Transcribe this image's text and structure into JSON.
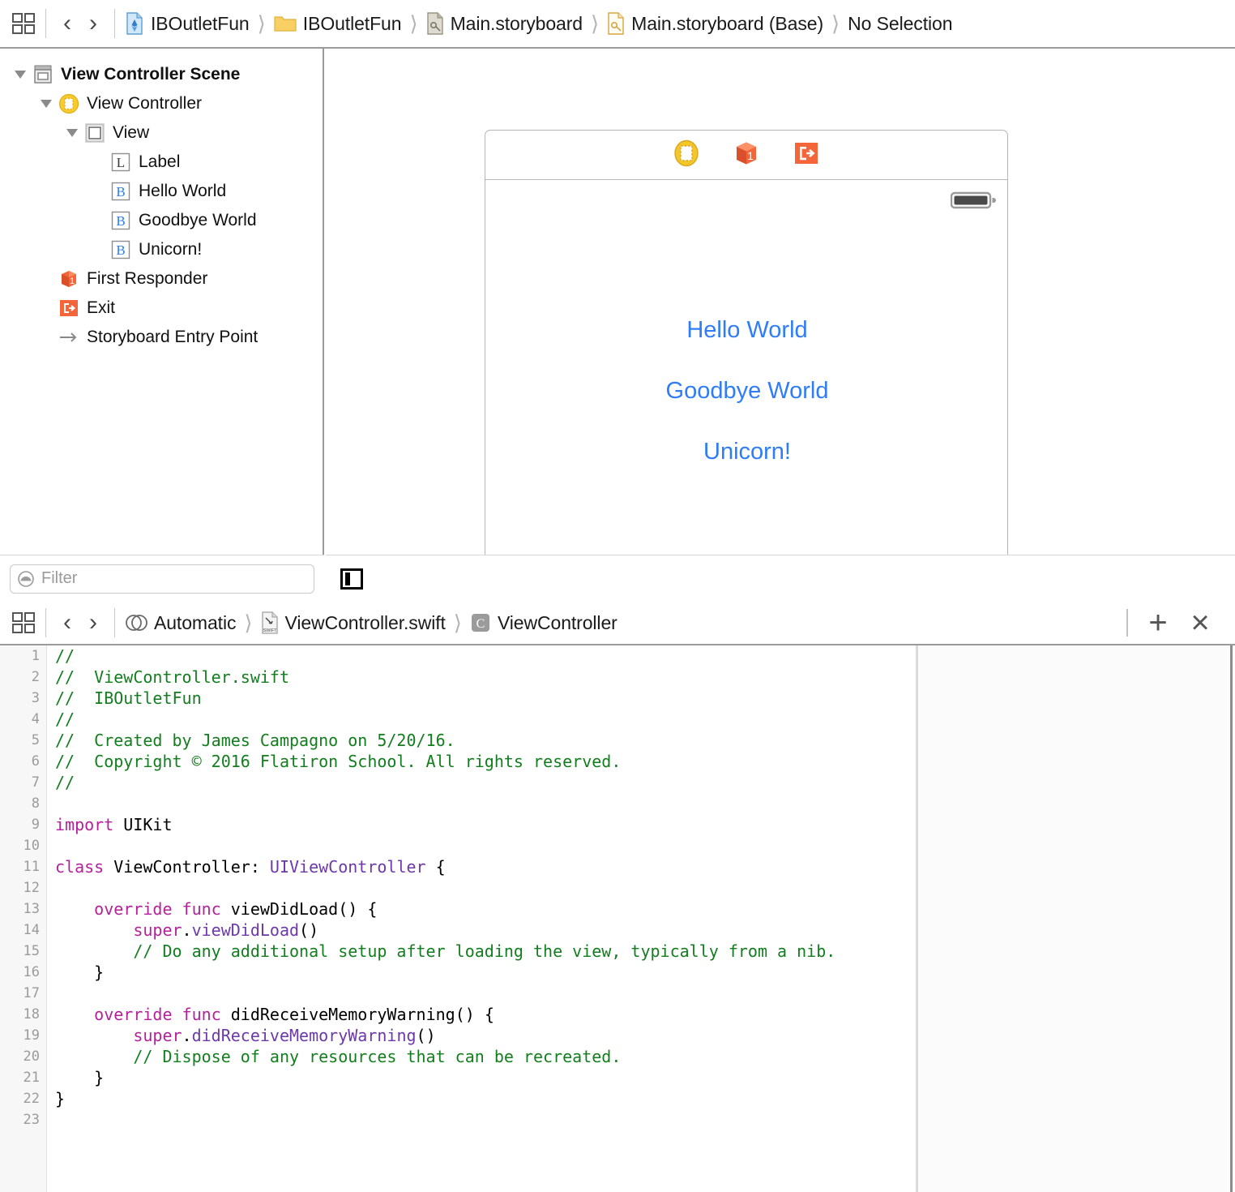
{
  "toolbar": {
    "grid_icon": "editor-grid-icon",
    "back_label": "‹",
    "forward_label": "›",
    "breadcrumbs": [
      {
        "label": "IBOutletFun",
        "icon": "xcode-project-icon"
      },
      {
        "label": "IBOutletFun",
        "icon": "folder-icon"
      },
      {
        "label": "Main.storyboard",
        "icon": "storyboard-file-icon"
      },
      {
        "label": "Main.storyboard (Base)",
        "icon": "storyboard-base-file-icon"
      },
      {
        "label": "No Selection",
        "icon": "none"
      }
    ]
  },
  "outline": {
    "filter_placeholder": "Filter",
    "filter_value": "",
    "items": [
      {
        "label": "View Controller Scene",
        "indent": 0,
        "twisty": "down",
        "icon": "scene-icon",
        "bold": true
      },
      {
        "label": "View Controller",
        "indent": 1,
        "twisty": "down",
        "icon": "view-controller-icon",
        "bold": false
      },
      {
        "label": "View",
        "indent": 2,
        "twisty": "down",
        "icon": "view-icon",
        "bold": false
      },
      {
        "label": "Label",
        "indent": 3,
        "twisty": "none",
        "icon": "label-icon",
        "bold": false
      },
      {
        "label": "Hello World",
        "indent": 3,
        "twisty": "none",
        "icon": "button-icon",
        "bold": false
      },
      {
        "label": "Goodbye World",
        "indent": 3,
        "twisty": "none",
        "icon": "button-icon",
        "bold": false
      },
      {
        "label": "Unicorn!",
        "indent": 3,
        "twisty": "none",
        "icon": "button-icon",
        "bold": false
      },
      {
        "label": "First Responder",
        "indent": 2,
        "twisty": "none",
        "icon": "first-responder-icon",
        "bold": false
      },
      {
        "label": "Exit",
        "indent": 2,
        "twisty": "none",
        "icon": "exit-icon",
        "bold": false
      },
      {
        "label": "Storyboard Entry Point",
        "indent": 2,
        "twisty": "none",
        "icon": "entry-point-arrow-icon",
        "bold": false
      }
    ]
  },
  "canvas": {
    "scene_dock_icons": [
      "view-controller-icon",
      "first-responder-icon",
      "exit-icon"
    ],
    "status_bar_icon": "battery-icon",
    "buttons": [
      {
        "title": "Hello World"
      },
      {
        "title": "Goodbye World"
      },
      {
        "title": "Unicorn!"
      }
    ],
    "layout_toggle_icon": "document-outline-toggle-icon"
  },
  "editor_bar": {
    "grid_icon": "editor-grid-icon",
    "back_label": "‹",
    "forward_label": "›",
    "breadcrumbs": [
      {
        "label": "Automatic",
        "icon": "automatic-icon"
      },
      {
        "label": "ViewController.swift",
        "icon": "swift-file-icon"
      },
      {
        "label": "ViewController",
        "icon": "class-c-icon"
      }
    ],
    "add_editor_label": "+",
    "close_editor_label": "×"
  },
  "code": {
    "language": "swift",
    "line_numbers": [
      1,
      2,
      3,
      4,
      5,
      6,
      7,
      8,
      9,
      10,
      11,
      12,
      13,
      14,
      15,
      16,
      17,
      18,
      19,
      20,
      21,
      22,
      23
    ],
    "lines": [
      [
        {
          "t": "//",
          "c": "comment"
        }
      ],
      [
        {
          "t": "//  ViewController.swift",
          "c": "comment"
        }
      ],
      [
        {
          "t": "//  IBOutletFun",
          "c": "comment"
        }
      ],
      [
        {
          "t": "//",
          "c": "comment"
        }
      ],
      [
        {
          "t": "//  Created by James Campagno on 5/20/16.",
          "c": "comment"
        }
      ],
      [
        {
          "t": "//  Copyright © 2016 Flatiron School. All rights reserved.",
          "c": "comment"
        }
      ],
      [
        {
          "t": "//",
          "c": "comment"
        }
      ],
      [],
      [
        {
          "t": "import",
          "c": "keyword"
        },
        {
          "t": " UIKit",
          "c": "plain"
        }
      ],
      [],
      [
        {
          "t": "class",
          "c": "keyword"
        },
        {
          "t": " ViewController: ",
          "c": "plain"
        },
        {
          "t": "UIViewController",
          "c": "type"
        },
        {
          "t": " {",
          "c": "plain"
        }
      ],
      [],
      [
        {
          "t": "    ",
          "c": "plain"
        },
        {
          "t": "override func",
          "c": "keyword"
        },
        {
          "t": " viewDidLoad() {",
          "c": "plain"
        }
      ],
      [
        {
          "t": "        ",
          "c": "plain"
        },
        {
          "t": "super",
          "c": "keyword"
        },
        {
          "t": ".",
          "c": "plain"
        },
        {
          "t": "viewDidLoad",
          "c": "type"
        },
        {
          "t": "()",
          "c": "plain"
        }
      ],
      [
        {
          "t": "        ",
          "c": "plain"
        },
        {
          "t": "// Do any additional setup after loading the view, typically from a nib.",
          "c": "comment"
        }
      ],
      [
        {
          "t": "    }",
          "c": "plain"
        }
      ],
      [],
      [
        {
          "t": "    ",
          "c": "plain"
        },
        {
          "t": "override func",
          "c": "keyword"
        },
        {
          "t": " didReceiveMemoryWarning() {",
          "c": "plain"
        }
      ],
      [
        {
          "t": "        ",
          "c": "plain"
        },
        {
          "t": "super",
          "c": "keyword"
        },
        {
          "t": ".",
          "c": "plain"
        },
        {
          "t": "didReceiveMemoryWarning",
          "c": "type"
        },
        {
          "t": "()",
          "c": "plain"
        }
      ],
      [
        {
          "t": "        ",
          "c": "plain"
        },
        {
          "t": "// Dispose of any resources that can be recreated.",
          "c": "comment"
        }
      ],
      [
        {
          "t": "    }",
          "c": "plain"
        }
      ],
      [
        {
          "t": "}",
          "c": "plain"
        }
      ],
      []
    ]
  },
  "colors": {
    "comment": "#127e1e",
    "keyword": "#b4219a",
    "type": "#6c38aa",
    "plain": "#000000",
    "button_tint": "#2e7df6",
    "accent_orange": "#f4663a",
    "accent_yellow": "#f5c518"
  }
}
